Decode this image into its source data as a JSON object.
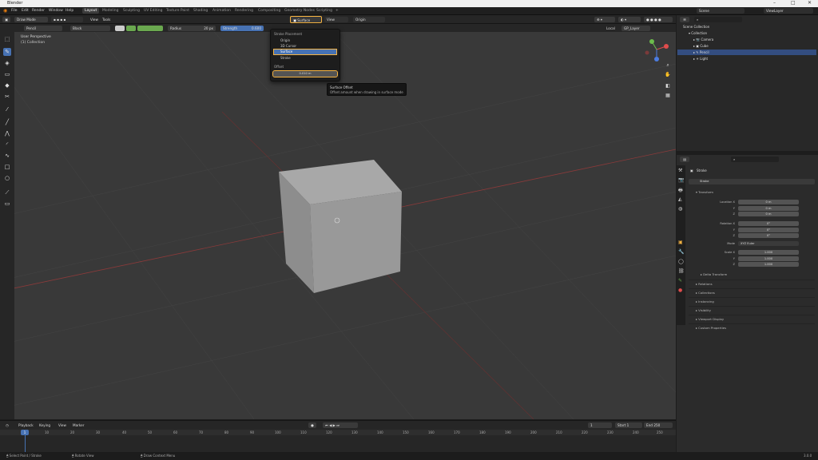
{
  "window": {
    "title": "Blender",
    "min": "–",
    "max": "□",
    "close": "✕"
  },
  "menu": [
    "File",
    "Edit",
    "Render",
    "Window",
    "Help"
  ],
  "workspaces": [
    "Layout",
    "Modeling",
    "Sculpting",
    "UV Editing",
    "Texture Paint",
    "Shading",
    "Animation",
    "Rendering",
    "Compositing",
    "Geometry Nodes",
    "Scripting",
    "+"
  ],
  "scene": {
    "label": "Scene",
    "view_layer": "ViewLayer"
  },
  "header": {
    "mode": "Draw Mode",
    "view": "View",
    "tools": "Tools",
    "placement": "Surface",
    "view2": "View",
    "origin": "Origin"
  },
  "header2": {
    "brush": "Pencil",
    "layer": "Black",
    "radius_label": "Radius",
    "radius_value": "20 px",
    "strength_label": "Strength",
    "strength_value": "0.600"
  },
  "viewport": {
    "perspective": "User Perspective",
    "collection": "(1) Collection",
    "local_label": "Local",
    "layers_label": "GP_Layer"
  },
  "dropdown": {
    "title": "Stroke Placement",
    "items": [
      "Origin",
      "3D Cursor",
      "Surface",
      "Stroke"
    ],
    "selected": "Surface",
    "offset_label": "Offset",
    "offset_value": "0.010 m"
  },
  "tooltip": {
    "title": "Surface Offset",
    "body": "Offset amount when drawing in surface mode"
  },
  "outliner": {
    "title": "Scene Collection",
    "rows": [
      "Collection",
      "Camera",
      "Cube",
      "Pencil",
      "Light"
    ]
  },
  "properties": {
    "search_placeholder": "",
    "object_name": "Stroke",
    "data_name": "Stroke",
    "transform": "Transform",
    "location": {
      "label": "Location X",
      "values": [
        "0 m",
        "0 m",
        "0 m"
      ]
    },
    "rotation": {
      "label": "Rotation X",
      "values": [
        "0°",
        "0°",
        "0°"
      ]
    },
    "mode_label": "Mode",
    "mode_value": "XYZ Euler",
    "scale": {
      "label": "Scale X",
      "values": [
        "1.000",
        "1.000",
        "1.000"
      ]
    },
    "axis_y": "Y",
    "axis_z": "Z",
    "delta": "Delta Transform",
    "panels": [
      "Relations",
      "Collections",
      "Instancing",
      "Visibility",
      "Viewport Display",
      "Custom Properties"
    ]
  },
  "timeline": {
    "menus": [
      "Playback",
      "Keying",
      "View",
      "Marker"
    ],
    "current_frame": "1",
    "start_label": "Start",
    "start": "1",
    "end_label": "End",
    "end": "250",
    "ticks": [
      "1",
      "10",
      "20",
      "30",
      "40",
      "50",
      "60",
      "70",
      "80",
      "90",
      "100",
      "110",
      "120",
      "130",
      "140",
      "150",
      "160",
      "170",
      "180",
      "190",
      "200",
      "210",
      "220",
      "230",
      "240",
      "250"
    ]
  },
  "status": {
    "left": "Select Point / Stroke",
    "mid": "Rotate View",
    "right": "Draw Context Menu",
    "version": "3.0.0"
  },
  "colors": {
    "accent": "#4772b3",
    "highlight": "#f5b342",
    "green": "#6aa84f"
  }
}
